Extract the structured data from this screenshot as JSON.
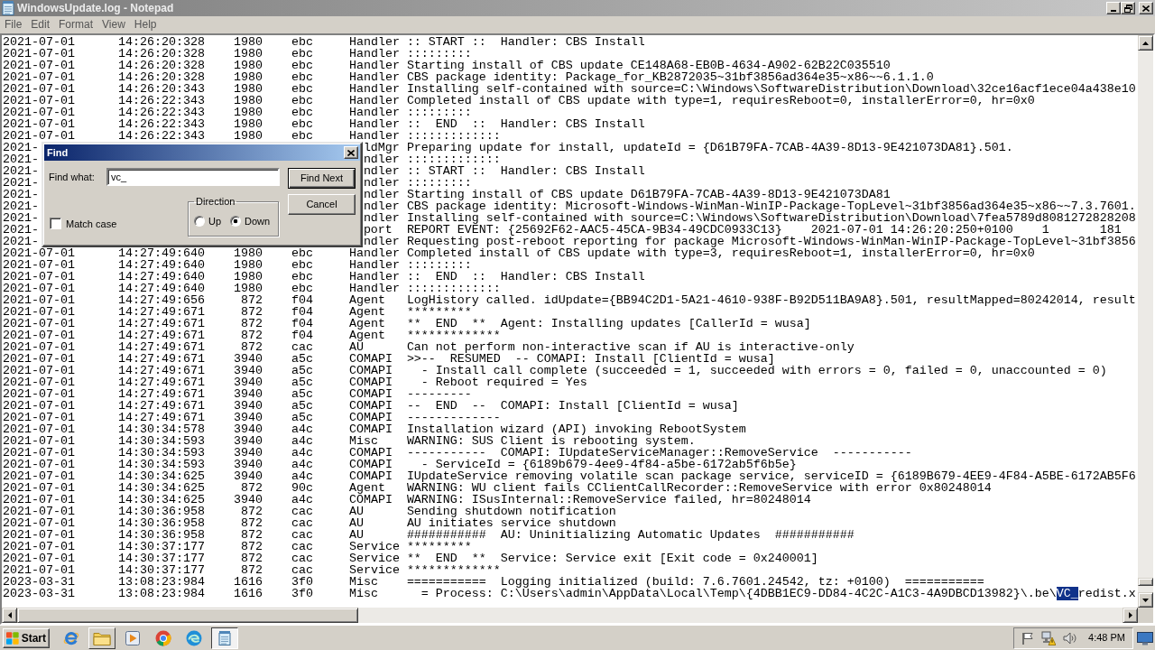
{
  "window": {
    "title": "WindowsUpdate.log - Notepad"
  },
  "menu": [
    "File",
    "Edit",
    "Format",
    "View",
    "Help"
  ],
  "log_lines": [
    {
      "date": "2021-07-01",
      "time": "14:26:20:328",
      "pid": "1980",
      "tid": "ebc",
      "component": "Handler",
      "message": ":: START ::  Handler: CBS Install"
    },
    {
      "date": "2021-07-01",
      "time": "14:26:20:328",
      "pid": "1980",
      "tid": "ebc",
      "component": "Handler",
      "message": ":::::::::"
    },
    {
      "date": "2021-07-01",
      "time": "14:26:20:328",
      "pid": "1980",
      "tid": "ebc",
      "component": "Handler",
      "message": "Starting install of CBS update CE148A68-EB0B-4634-A902-62B22C035510"
    },
    {
      "date": "2021-07-01",
      "time": "14:26:20:328",
      "pid": "1980",
      "tid": "ebc",
      "component": "Handler",
      "message": "CBS package identity: Package_for_KB2872035~31bf3856ad364e35~x86~~6.1.1.0"
    },
    {
      "date": "2021-07-01",
      "time": "14:26:20:343",
      "pid": "1980",
      "tid": "ebc",
      "component": "Handler",
      "message": "Installing self-contained with source=C:\\Windows\\SoftwareDistribution\\Download\\32ce16acf1ece04a438e10"
    },
    {
      "date": "2021-07-01",
      "time": "14:26:22:343",
      "pid": "1980",
      "tid": "ebc",
      "component": "Handler",
      "message": "Completed install of CBS update with type=1, requiresReboot=0, installerError=0, hr=0x0"
    },
    {
      "date": "2021-07-01",
      "time": "14:26:22:343",
      "pid": "1980",
      "tid": "ebc",
      "component": "Handler",
      "message": ":::::::::"
    },
    {
      "date": "2021-07-01",
      "time": "14:26:22:343",
      "pid": "1980",
      "tid": "ebc",
      "component": "Handler",
      "message": "::  END  ::  Handler: CBS Install"
    },
    {
      "date": "2021-07-01",
      "time": "14:26:22:343",
      "pid": "1980",
      "tid": "ebc",
      "component": "Handler",
      "message": ":::::::::::::"
    },
    {
      "date": "2021-",
      "component_tail": "ldMgr",
      "message": "Preparing update for install, updateId = {D61B79FA-7CAB-4A39-8D13-9E421073DA81}.501."
    },
    {
      "date": "2021-",
      "component_tail": "ndler",
      "message": ":::::::::::::"
    },
    {
      "date": "2021-",
      "component_tail": "ndler",
      "message": ":: START ::  Handler: CBS Install"
    },
    {
      "date": "2021-",
      "component_tail": "ndler",
      "message": ":::::::::"
    },
    {
      "date": "2021-",
      "component_tail": "ndler",
      "message": "Starting install of CBS update D61B79FA-7CAB-4A39-8D13-9E421073DA81"
    },
    {
      "date": "2021-",
      "component_tail": "ndler",
      "message": "CBS package identity: Microsoft-Windows-WinMan-WinIP-Package-TopLevel~31bf3856ad364e35~x86~~7.3.7601."
    },
    {
      "date": "2021-",
      "component_tail": "ndler",
      "message": "Installing self-contained with source=C:\\Windows\\SoftwareDistribution\\Download\\7fea5789d8081272828208"
    },
    {
      "date": "2021-",
      "component_tail": "port",
      "message": "REPORT EVENT: {25692F62-AAC5-45CA-9B34-49CDC0933C13}\t2021-07-01 14:26:20:250+0100\t1\t181"
    },
    {
      "date": "2021-",
      "component_tail": "ndler",
      "message": "Requesting post-reboot reporting for package Microsoft-Windows-WinMan-WinIP-Package-TopLevel~31bf3856"
    },
    {
      "date": "2021-07-01",
      "time": "14:27:49:640",
      "pid": "1980",
      "tid": "ebc",
      "component": "Handler",
      "message": "Completed install of CBS update with type=3, requiresReboot=1, installerError=0, hr=0x0"
    },
    {
      "date": "2021-07-01",
      "time": "14:27:49:640",
      "pid": "1980",
      "tid": "ebc",
      "component": "Handler",
      "message": ":::::::::"
    },
    {
      "date": "2021-07-01",
      "time": "14:27:49:640",
      "pid": "1980",
      "tid": "ebc",
      "component": "Handler",
      "message": "::  END  ::  Handler: CBS Install"
    },
    {
      "date": "2021-07-01",
      "time": "14:27:49:640",
      "pid": "1980",
      "tid": "ebc",
      "component": "Handler",
      "message": ":::::::::::::"
    },
    {
      "date": "2021-07-01",
      "time": "14:27:49:656",
      "pid": "872",
      "tid": "f04",
      "component": "Agent",
      "message": "LogHistory called. idUpdate={BB94C2D1-5A21-4610-938F-B92D511BA9A8}.501, resultMapped=80242014, result"
    },
    {
      "date": "2021-07-01",
      "time": "14:27:49:671",
      "pid": "872",
      "tid": "f04",
      "component": "Agent",
      "message": "*********"
    },
    {
      "date": "2021-07-01",
      "time": "14:27:49:671",
      "pid": "872",
      "tid": "f04",
      "component": "Agent",
      "message": "**  END  **  Agent: Installing updates [CallerId = wusa]"
    },
    {
      "date": "2021-07-01",
      "time": "14:27:49:671",
      "pid": "872",
      "tid": "f04",
      "component": "Agent",
      "message": "*************"
    },
    {
      "date": "2021-07-01",
      "time": "14:27:49:671",
      "pid": "872",
      "tid": "cac",
      "component": "AU",
      "message": "Can not perform non-interactive scan if AU is interactive-only"
    },
    {
      "date": "2021-07-01",
      "time": "14:27:49:671",
      "pid": "3940",
      "tid": "a5c",
      "component": "COMAPI",
      "message": ">>--  RESUMED  -- COMAPI: Install [ClientId = wusa]"
    },
    {
      "date": "2021-07-01",
      "time": "14:27:49:671",
      "pid": "3940",
      "tid": "a5c",
      "component": "COMAPI",
      "message": "  - Install call complete (succeeded = 1, succeeded with errors = 0, failed = 0, unaccounted = 0)"
    },
    {
      "date": "2021-07-01",
      "time": "14:27:49:671",
      "pid": "3940",
      "tid": "a5c",
      "component": "COMAPI",
      "message": "  - Reboot required = Yes"
    },
    {
      "date": "2021-07-01",
      "time": "14:27:49:671",
      "pid": "3940",
      "tid": "a5c",
      "component": "COMAPI",
      "message": "---------"
    },
    {
      "date": "2021-07-01",
      "time": "14:27:49:671",
      "pid": "3940",
      "tid": "a5c",
      "component": "COMAPI",
      "message": "--  END  --  COMAPI: Install [ClientId = wusa]"
    },
    {
      "date": "2021-07-01",
      "time": "14:27:49:671",
      "pid": "3940",
      "tid": "a5c",
      "component": "COMAPI",
      "message": "-------------"
    },
    {
      "date": "2021-07-01",
      "time": "14:30:34:578",
      "pid": "3940",
      "tid": "a4c",
      "component": "COMAPI",
      "message": "Installation wizard (API) invoking RebootSystem"
    },
    {
      "date": "2021-07-01",
      "time": "14:30:34:593",
      "pid": "3940",
      "tid": "a4c",
      "component": "Misc",
      "message": "WARNING: SUS Client is rebooting system."
    },
    {
      "date": "2021-07-01",
      "time": "14:30:34:593",
      "pid": "3940",
      "tid": "a4c",
      "component": "COMAPI",
      "message": "-----------  COMAPI: IUpdateServiceManager::RemoveService  -----------"
    },
    {
      "date": "2021-07-01",
      "time": "14:30:34:593",
      "pid": "3940",
      "tid": "a4c",
      "component": "COMAPI",
      "message": "  - ServiceId = {6189b679-4ee9-4f84-a5be-6172ab5f6b5e}"
    },
    {
      "date": "2021-07-01",
      "time": "14:30:34:625",
      "pid": "3940",
      "tid": "a4c",
      "component": "COMAPI",
      "message": "IUpdateService removing volatile scan package service, serviceID = {6189B679-4EE9-4F84-A5BE-6172AB5F6"
    },
    {
      "date": "2021-07-01",
      "time": "14:30:34:625",
      "pid": "872",
      "tid": "90c",
      "component": "Agent",
      "message": "WARNING: WU client fails CClientCallRecorder::RemoveService with error 0x80248014"
    },
    {
      "date": "2021-07-01",
      "time": "14:30:34:625",
      "pid": "3940",
      "tid": "a4c",
      "component": "COMAPI",
      "message": "WARNING: ISusInternal::RemoveService failed, hr=80248014"
    },
    {
      "date": "2021-07-01",
      "time": "14:30:36:958",
      "pid": "872",
      "tid": "cac",
      "component": "AU",
      "message": "Sending shutdown notification"
    },
    {
      "date": "2021-07-01",
      "time": "14:30:36:958",
      "pid": "872",
      "tid": "cac",
      "component": "AU",
      "message": "AU initiates service shutdown"
    },
    {
      "date": "2021-07-01",
      "time": "14:30:36:958",
      "pid": "872",
      "tid": "cac",
      "component": "AU",
      "message": "###########  AU: Uninitializing Automatic Updates  ###########"
    },
    {
      "date": "2021-07-01",
      "time": "14:30:37:177",
      "pid": "872",
      "tid": "cac",
      "component": "Service",
      "message": "*********"
    },
    {
      "date": "2021-07-01",
      "time": "14:30:37:177",
      "pid": "872",
      "tid": "cac",
      "component": "Service",
      "message": "**  END  **  Service: Service exit [Exit code = 0x240001]"
    },
    {
      "date": "2021-07-01",
      "time": "14:30:37:177",
      "pid": "872",
      "tid": "cac",
      "component": "Service",
      "message": "*************"
    },
    {
      "date": "2023-03-31",
      "time": "13:08:23:984",
      "pid": "1616",
      "tid": "3f0",
      "component": "Misc",
      "message": "===========  Logging initialized (build: 7.6.7601.24542, tz: +0100)  ==========="
    },
    {
      "date": "2023-03-31",
      "time": "13:08:23:984",
      "pid": "1616",
      "tid": "3f0",
      "component": "Misc",
      "message_parts": [
        {
          "text": "  = Process: C:\\Users\\admin\\AppData\\Local\\Temp\\{4DBB1EC9-DD84-4C2C-A1C3-4A9DBCD13982}\\.be\\",
          "selected": false
        },
        {
          "text": "VC_",
          "selected": true
        },
        {
          "text": "redist.x",
          "selected": false
        }
      ]
    }
  ],
  "find_dialog": {
    "title": "Find",
    "find_what_label": "Find what:",
    "find_what_value": "vc_",
    "buttons": [
      {
        "label": "Find Next",
        "default": true
      },
      {
        "label": "Cancel",
        "default": false
      }
    ],
    "direction": {
      "label": "Direction",
      "options": [
        {
          "label": "Up",
          "selected": false
        },
        {
          "label": "Down",
          "selected": true
        }
      ]
    },
    "match_case": {
      "label": "Match case",
      "checked": false
    }
  },
  "taskbar": {
    "start": "Start",
    "buttons": [
      {
        "kind": "browser_e",
        "running": false,
        "selected": false
      },
      {
        "kind": "folder",
        "running": true,
        "selected": false
      },
      {
        "kind": "media",
        "running": false,
        "selected": false
      },
      {
        "kind": "browser_ball",
        "running": false,
        "selected": false
      },
      {
        "kind": "browser_wave",
        "running": false,
        "selected": false
      },
      {
        "kind": "notepad",
        "running": true,
        "selected": true
      }
    ],
    "tray": [
      {
        "kind": "flag"
      },
      {
        "kind": "network"
      },
      {
        "kind": "speaker"
      }
    ],
    "clock": "4:48 PM"
  }
}
